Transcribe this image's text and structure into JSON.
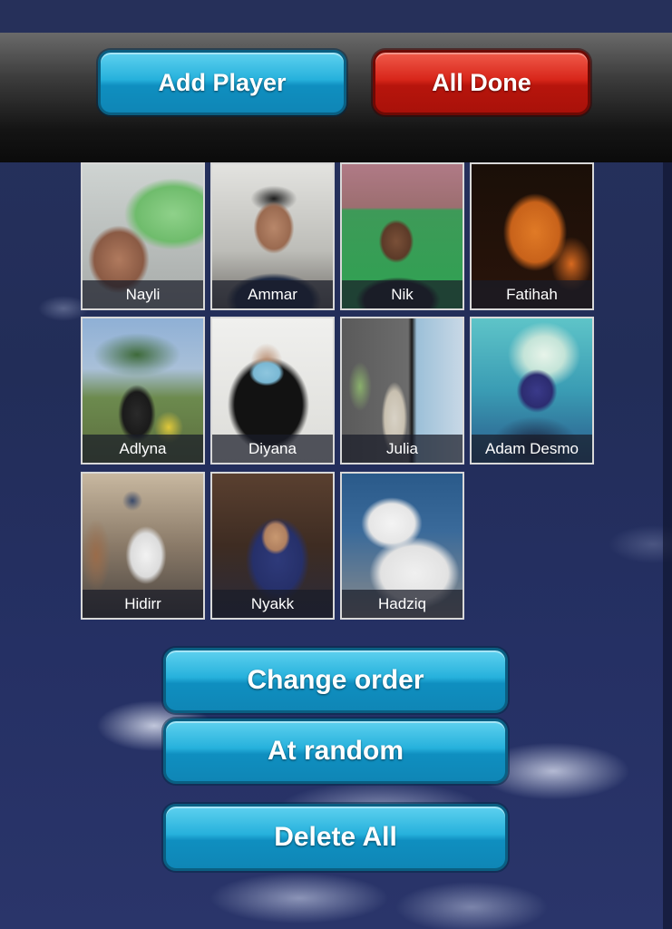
{
  "toolbar": {
    "add_player_label": "Add Player",
    "all_done_label": "All Done"
  },
  "players": [
    {
      "name": "Nayli"
    },
    {
      "name": "Ammar"
    },
    {
      "name": "Nik"
    },
    {
      "name": "Fatihah"
    },
    {
      "name": "Adlyna"
    },
    {
      "name": "Diyana"
    },
    {
      "name": "Julia"
    },
    {
      "name": "Adam Desmo"
    },
    {
      "name": "Hidirr"
    },
    {
      "name": "Nyakk"
    },
    {
      "name": "Hadziq"
    }
  ],
  "actions": {
    "change_order_label": "Change order",
    "at_random_label": "At random",
    "delete_all_label": "Delete All"
  },
  "colors": {
    "blue_button": "#1aa6d4",
    "red_button": "#d02518",
    "background": "#222d58"
  }
}
